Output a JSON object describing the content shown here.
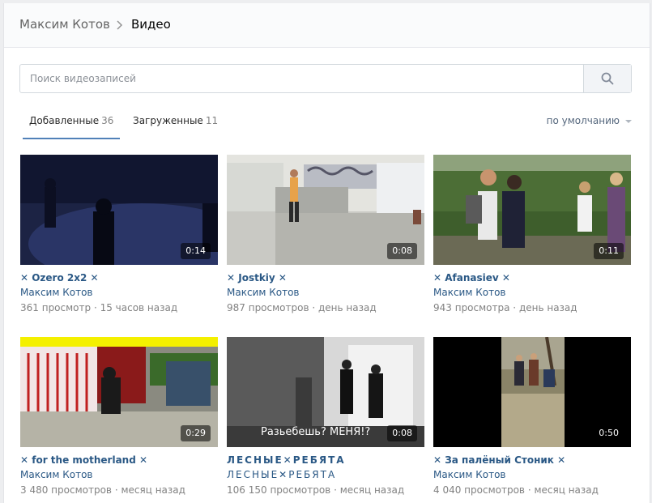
{
  "breadcrumb": {
    "user": "Максим Котов",
    "current": "Видео"
  },
  "search": {
    "placeholder": "Поиск видеозаписей"
  },
  "tabs": [
    {
      "label": "Добавленные",
      "count": "36"
    },
    {
      "label": "Загруженные",
      "count": "11"
    }
  ],
  "sort": {
    "label": "по умолчанию"
  },
  "videos": [
    {
      "title": "✕ Ozero 2x2 ✕",
      "author": "Максим Котов",
      "views": "361 просмотр",
      "date": "15 часов назад",
      "duration": "0:14"
    },
    {
      "title": "✕ Jostkiy ✕",
      "author": "Максим Котов",
      "views": "987 просмотров",
      "date": "день назад",
      "duration": "0:08"
    },
    {
      "title": "✕ Afanasiev ✕",
      "author": "Максим Котов",
      "views": "943 просмотра",
      "date": "день назад",
      "duration": "0:11"
    },
    {
      "title": "✕ for the motherland ✕",
      "author": "Максим Котов",
      "views": "3 480 просмотров",
      "date": "месяц назад",
      "duration": "0:29"
    },
    {
      "title": "ЛЕСНЫЕ✕РЕБЯТА",
      "author": "ЛЕСНЫЕ✕РЕБЯТА",
      "views": "106 150 просмотров",
      "date": "месяц назад",
      "duration": "0:08",
      "caption": "Разьебешь? МЕНЯ!?"
    },
    {
      "title": "✕ За палёный Стоник ✕",
      "author": "Максим Котов",
      "views": "4 040 просмотров",
      "date": "месяц назад",
      "duration": "0:50"
    }
  ],
  "colors": {
    "link": "#2a5885",
    "accent": "#5181b8",
    "meta": "#828282"
  }
}
